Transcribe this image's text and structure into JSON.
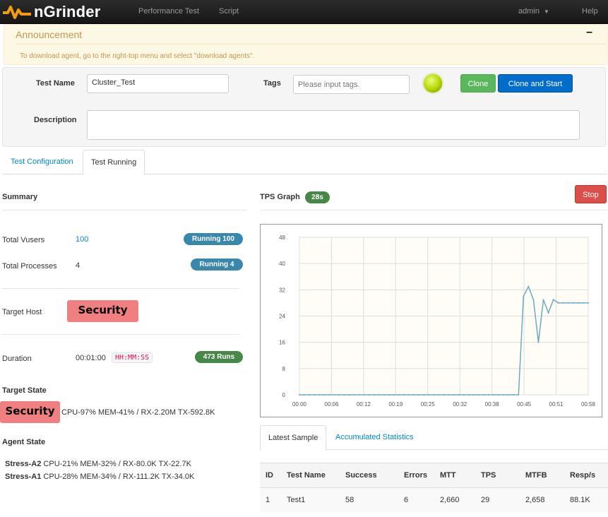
{
  "nav": {
    "brand": "nGrinder",
    "items": [
      "Performance Test",
      "Script"
    ],
    "user": "admin",
    "help": "Help"
  },
  "announcement": {
    "title": "Announcement",
    "collapse": "–",
    "message": "To download agent, go to the right-top menu and select \"download agents\"."
  },
  "test": {
    "name_label": "Test Name",
    "name_value": "Cluster_Test",
    "tags_label": "Tags",
    "tags_placeholder": "Please input tags.",
    "clone": "Clone",
    "clone_start": "Clone and Start",
    "desc_label": "Description",
    "desc_value": ""
  },
  "tabs": [
    "Test Configuration",
    "Test Running"
  ],
  "summary": {
    "title": "Summary",
    "total_vusers_label": "Total Vusers",
    "total_vusers": "100",
    "running_vusers_badge": "Running 100",
    "total_processes_label": "Total Processes",
    "total_processes": "4",
    "running_proc_badge": "Running 4",
    "target_host_label": "Target Host",
    "security_mark": "Security",
    "duration_label": "Duration",
    "duration": "00:01:00",
    "duration_format": "HH:MM:SS",
    "runs_badge": "473  Runs",
    "target_state_label": "Target State",
    "target_state_text": "CPU-97% MEM-41% / RX-2.20M TX-592.8K",
    "agent_state_label": "Agent State",
    "agents": [
      {
        "name": "Stress-A2",
        "stats": "CPU-21% MEM-32% / RX-80.0K TX-22.7K"
      },
      {
        "name": "Stress-A1",
        "stats": "CPU-28% MEM-34% / RX-111.2K TX-34.0K"
      }
    ]
  },
  "graph": {
    "title": "TPS Graph",
    "elapsed_badge": "28s",
    "stop": "Stop"
  },
  "chart_data": {
    "type": "line",
    "x": [
      "00:00",
      "00:01",
      "00:02",
      "00:03",
      "00:04",
      "00:05",
      "00:06",
      "00:07",
      "00:08",
      "00:09",
      "00:10",
      "00:11",
      "00:12",
      "00:13",
      "00:14",
      "00:15",
      "00:16",
      "00:17",
      "00:18",
      "00:19",
      "00:20",
      "00:21",
      "00:22",
      "00:23",
      "00:24",
      "00:25",
      "00:26",
      "00:27",
      "00:28",
      "00:29",
      "00:30",
      "00:31",
      "00:32",
      "00:33",
      "00:34",
      "00:35",
      "00:36",
      "00:37",
      "00:38",
      "00:39",
      "00:40",
      "00:41",
      "00:42",
      "00:43",
      "00:44",
      "00:45",
      "00:46",
      "00:47",
      "00:48",
      "00:49",
      "00:50",
      "00:51",
      "00:52",
      "00:53",
      "00:54",
      "00:55",
      "00:56",
      "00:57",
      "00:58"
    ],
    "values": [
      0,
      0,
      0,
      0,
      0,
      0,
      0,
      0,
      0,
      0,
      0,
      0,
      0,
      0,
      0,
      0,
      0,
      0,
      0,
      0,
      0,
      0,
      0,
      0,
      0,
      0,
      0,
      0,
      0,
      0,
      0,
      0,
      0,
      0,
      0,
      0,
      0,
      0,
      0,
      0,
      0,
      0,
      0,
      0,
      0,
      30,
      33,
      29,
      16,
      29,
      25,
      29,
      28,
      28,
      28,
      28,
      28,
      28,
      28
    ],
    "x_ticks": [
      "00:00",
      "00:06",
      "00:12",
      "00:19",
      "00:25",
      "00:32",
      "00:38",
      "00:45",
      "00:51",
      "00:58"
    ],
    "y_ticks": [
      0,
      8,
      16,
      24,
      32,
      40,
      48
    ],
    "ylim": [
      0,
      48
    ],
    "grid": true,
    "colors": {
      "line": "#6aacc1",
      "plot_bg": "#fffdf6",
      "grid": "#dddddd"
    }
  },
  "stats": {
    "tabs": [
      "Latest Sample",
      "Accumulated Statistics"
    ],
    "headers": [
      "ID",
      "Test Name",
      "Success",
      "Errors",
      "MTT",
      "TPS",
      "MTFB",
      "Resp/s"
    ],
    "rows": [
      [
        "1",
        "Test1",
        "58",
        "6",
        "2,660",
        "29",
        "2,658",
        "88.1K"
      ]
    ]
  },
  "colors": {
    "green": "#5bb75b",
    "blue": "#006dcc",
    "red": "#da4f49",
    "badge_blue": "#3a87ad",
    "badge_green": "#468847",
    "link": "#0088cc"
  }
}
